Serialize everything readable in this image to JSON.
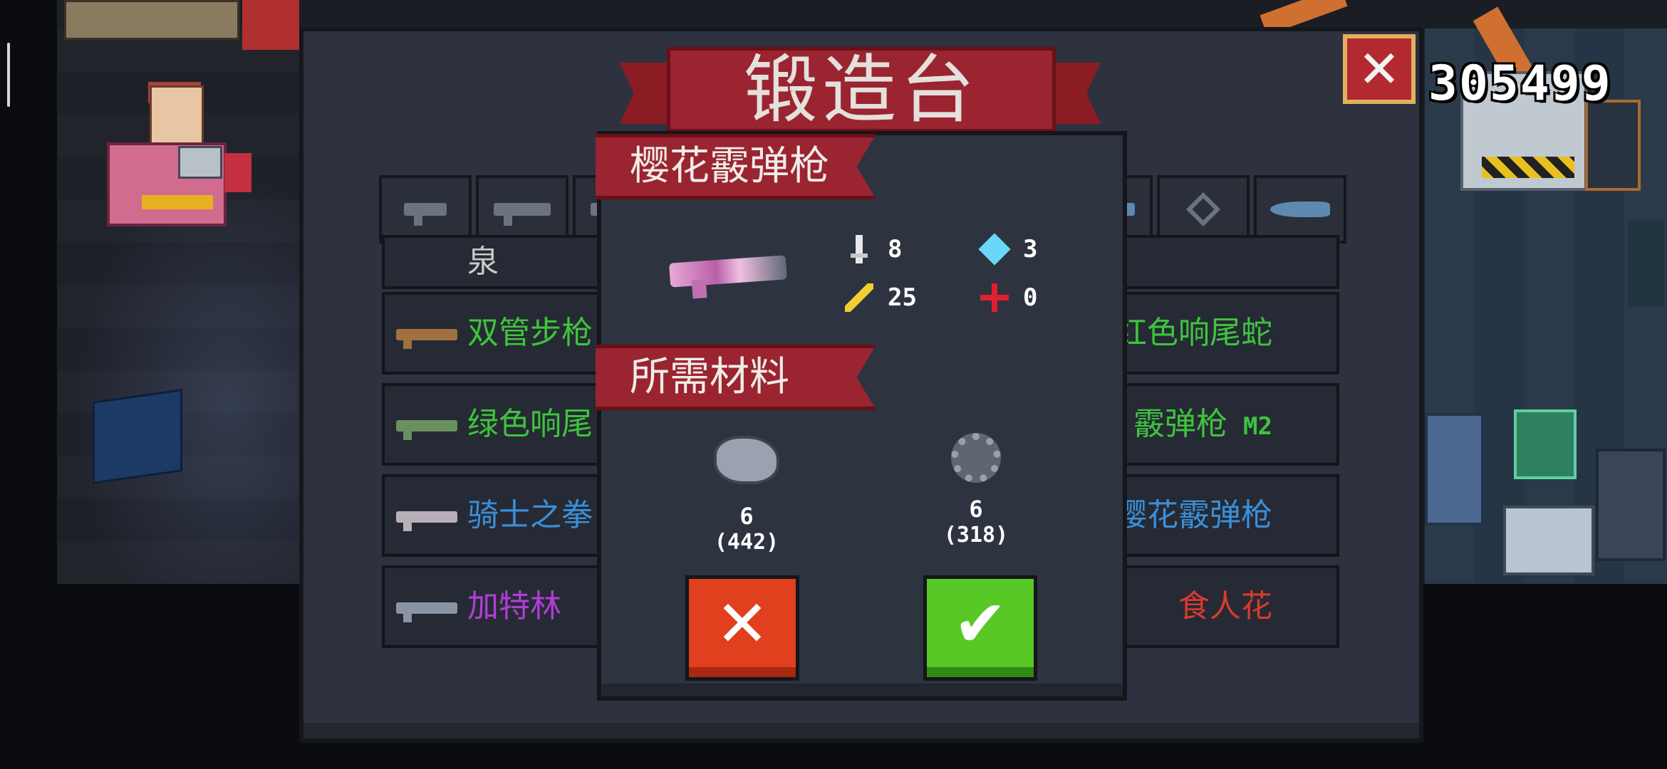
{
  "forge": {
    "title": "锻造台",
    "close_label": "✕",
    "gems": "305499"
  },
  "tabs": [
    {
      "icon": "pistol-icon"
    },
    {
      "icon": "rifle-icon"
    },
    {
      "icon": "shotgun-icon"
    },
    {
      "icon": "lance-icon"
    },
    {
      "icon": "diamond-icon"
    },
    {
      "icon": "shark-icon"
    }
  ],
  "weapon_list": [
    {
      "left": "泉",
      "right": "",
      "left_color": "#c9c9c9",
      "right_color": "#c9c9c9"
    },
    {
      "left": "双管步枪",
      "right": "红色响尾蛇",
      "left_color": "#3ec43e",
      "right_color": "#3ec43e"
    },
    {
      "left": "绿色响尾",
      "right": "霰弹枪",
      "right_tag": "M2",
      "left_color": "#3ec43e",
      "right_color": "#3ec43e"
    },
    {
      "left": "骑士之拳",
      "right": "樱花霰弹枪",
      "left_color": "#3a8fd8",
      "right_color": "#3a8fd8"
    },
    {
      "left": "加特林",
      "right": "食人花",
      "left_color": "#b03ed8",
      "right_color": "#d83a2e"
    }
  ],
  "popup": {
    "weapon_name": "樱花霰弹枪",
    "stats": {
      "damage": "8",
      "energy": "3",
      "crit": "25",
      "accuracy": "0"
    },
    "materials_title": "所需材料",
    "materials": [
      {
        "icon": "ore-icon",
        "need": "6",
        "have": "(442)"
      },
      {
        "icon": "gear-icon",
        "need": "6",
        "have": "(318)"
      }
    ],
    "cancel_label": "✕",
    "confirm_label": "✔"
  },
  "colors": {
    "ribbon": "#9a2430",
    "cancel": "#e0401e",
    "confirm": "#58c826",
    "panel": "#2d323e"
  }
}
